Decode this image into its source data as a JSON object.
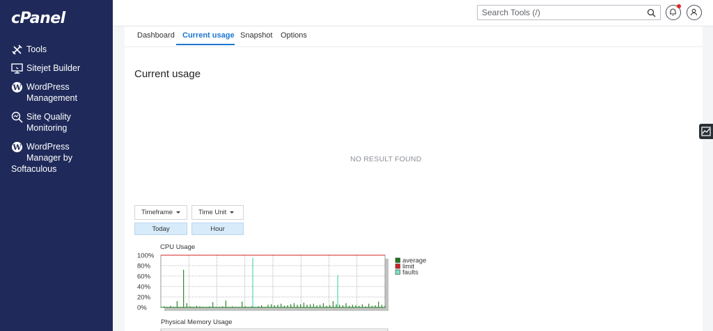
{
  "sidebar": {
    "logo": "cPanel",
    "items": [
      {
        "label": "Tools",
        "icon": "tools-icon"
      },
      {
        "label": "Sitejet Builder",
        "icon": "sitejet-icon"
      },
      {
        "label": "WordPress",
        "label2": "Management",
        "icon": "wordpress-icon"
      },
      {
        "label": "Site Quality",
        "label2": "Monitoring",
        "icon": "site-quality-icon"
      },
      {
        "label": "WordPress",
        "label2": "Manager by",
        "label3": "Softaculous",
        "icon": "wordpress-icon"
      }
    ]
  },
  "header": {
    "search_placeholder": "Search Tools (/)"
  },
  "tabs": [
    {
      "label": "Dashboard"
    },
    {
      "label": "Current usage",
      "active": true
    },
    {
      "label": "Snapshot"
    },
    {
      "label": "Options"
    }
  ],
  "main": {
    "title": "Current usage",
    "no_result": "NO RESULT FOUND",
    "timeframe_label": "Timeframe",
    "timeframe_value": "Today",
    "timeunit_label": "Time Unit",
    "timeunit_value": "Hour"
  },
  "colors": {
    "sidebar_bg": "#1f2a5a",
    "accent": "#1b76d1",
    "average": "#1a7a1a",
    "limit": "#d42020",
    "faults": "#7fe0c4"
  },
  "chart_data": [
    {
      "type": "line",
      "title": "CPU Usage",
      "ylabel": "",
      "yticks": [
        "100%",
        "80%",
        "60%",
        "40%",
        "20%",
        "0%"
      ],
      "ylim": [
        0,
        100
      ],
      "legend": [
        "average",
        "limit",
        "faults"
      ],
      "legend_placement": "right",
      "grid": true,
      "series": [
        {
          "name": "average",
          "values": [
            1,
            2,
            1,
            3,
            1,
            12,
            1,
            72,
            8,
            2,
            1,
            3,
            2,
            1,
            1,
            2,
            10,
            1,
            1,
            2,
            13,
            1,
            2,
            1,
            1,
            11,
            2,
            1,
            2,
            1,
            2,
            4,
            1,
            5,
            6,
            4,
            5,
            7,
            3,
            4,
            6,
            8,
            5,
            6,
            9,
            5,
            6,
            7,
            4,
            5,
            8,
            3,
            4,
            12,
            6,
            5,
            4,
            8,
            3,
            5,
            4,
            3,
            6,
            2,
            7,
            3,
            4,
            11,
            5,
            3
          ]
        },
        {
          "name": "limit",
          "values": [
            100
          ]
        },
        {
          "name": "faults",
          "values": [
            0,
            0,
            0,
            0,
            0,
            0,
            0,
            0,
            0,
            0,
            0,
            0,
            0,
            0,
            0,
            0,
            0,
            0,
            0,
            0,
            0,
            0,
            0,
            0,
            0,
            0,
            0,
            0,
            0,
            0,
            0,
            0,
            0,
            0,
            0,
            0,
            0,
            0,
            0,
            0,
            0,
            0,
            0,
            0,
            0,
            0,
            0,
            0,
            0,
            0,
            0,
            0,
            0,
            0,
            0,
            0,
            0,
            0,
            0,
            0,
            0,
            0,
            0,
            0,
            0,
            0,
            0,
            0,
            0,
            0
          ]
        }
      ],
      "spikes": [
        {
          "series": "average",
          "value": 72
        },
        {
          "series": "faults",
          "value": 95
        },
        {
          "series": "faults",
          "value": 62
        }
      ]
    },
    {
      "type": "line",
      "title": "Physical Memory Usage"
    }
  ]
}
